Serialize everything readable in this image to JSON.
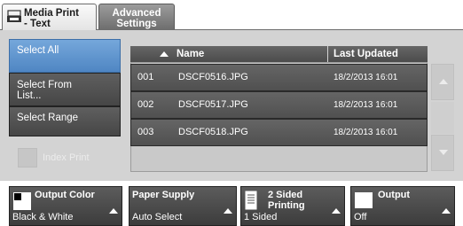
{
  "tabs": [
    {
      "label_line1": "Media Print",
      "label_line2": "- Text"
    },
    {
      "label_line1": "Advanced",
      "label_line2": "Settings"
    }
  ],
  "left_buttons": [
    {
      "label": "Select All",
      "selected": true
    },
    {
      "label_line1": "Select From",
      "label_line2": "List..."
    },
    {
      "label": "Select Range"
    }
  ],
  "index_print": {
    "label": "Index Print"
  },
  "table": {
    "columns": [
      "Name",
      "Last Updated"
    ],
    "rows": [
      {
        "num": "001",
        "name": "DSCF0516.JPG",
        "updated": "18/2/2013 16:01"
      },
      {
        "num": "002",
        "name": "DSCF0517.JPG",
        "updated": "18/2/2013 16:01"
      },
      {
        "num": "003",
        "name": "DSCF0518.JPG",
        "updated": "18/2/2013 16:01"
      }
    ]
  },
  "bottom_bar": {
    "output_color": {
      "label": "Output Color",
      "value": "Black & White"
    },
    "paper_supply": {
      "label": "Paper Supply",
      "value": "Auto Select"
    },
    "two_sided": {
      "label_line1": "2 Sided",
      "label_line2": "Printing",
      "value": "1 Sided"
    },
    "output": {
      "label": "Output",
      "value": "Off"
    }
  },
  "colors": {
    "selected_blue": "#5f93cd",
    "dark_button": "#505050",
    "panel_gray": "#d3d3d3"
  }
}
